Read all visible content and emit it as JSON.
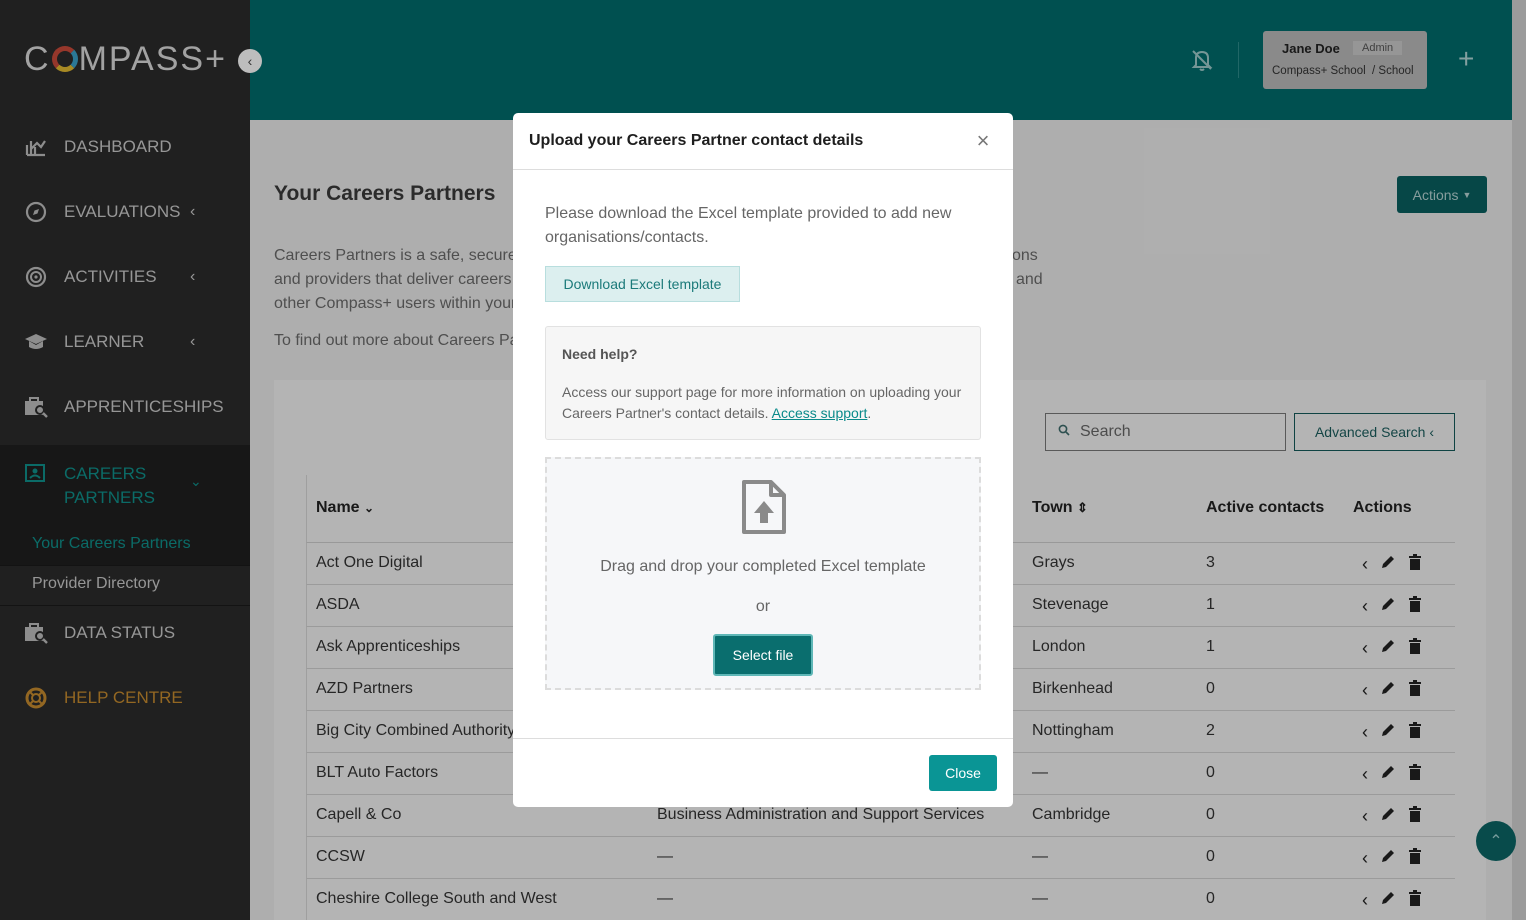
{
  "app": {
    "logo_text_left": "C",
    "logo_text_right": "MPASS+"
  },
  "sidebar": {
    "items": [
      {
        "label": "DASHBOARD",
        "icon": "chart-icon"
      },
      {
        "label": "EVALUATIONS",
        "icon": "compass-icon"
      },
      {
        "label": "ACTIVITIES",
        "icon": "target-icon"
      },
      {
        "label": "LEARNER",
        "icon": "graduation-cap-icon"
      },
      {
        "label": "APPRENTICESHIPS",
        "icon": "briefcase-search-icon"
      },
      {
        "label": "CAREERS PARTNERS",
        "icon": "id-card-icon",
        "active": true
      },
      {
        "label": "DATA STATUS",
        "icon": "briefcase-search-icon"
      },
      {
        "label": "HELP CENTRE",
        "icon": "lifebuoy-icon"
      }
    ],
    "subitems": [
      {
        "label": "Your Careers Partners",
        "active": true
      },
      {
        "label": "Provider Directory"
      }
    ]
  },
  "header": {
    "user_name": "Jane Doe",
    "user_role": "Admin",
    "user_org": "Compass+ School",
    "user_org_suffix": "/ School"
  },
  "page": {
    "title": "Your Careers Partners",
    "actions_label": "Actions",
    "intro_line1": "Careers Partners is a safe, secure",
    "intro_line1_end": "ons",
    "intro_line2": "and providers that deliver careers",
    "intro_line2_end": "and",
    "intro_line3": "other Compass+ users within your",
    "intro2": "To find out more about Careers Pa",
    "search_placeholder": "Search",
    "advanced_search_label": "Advanced Search"
  },
  "table": {
    "headers": {
      "name": "Name",
      "town": "Town",
      "active_contacts": "Active contacts",
      "actions": "Actions"
    },
    "rows": [
      {
        "name": "Act One Digital",
        "sector": "",
        "town": "Grays",
        "contacts": "3"
      },
      {
        "name": "ASDA",
        "sector": "",
        "town": "Stevenage",
        "contacts": "1"
      },
      {
        "name": "Ask Apprenticeships",
        "sector": "",
        "town": "London",
        "contacts": "1"
      },
      {
        "name": "AZD Partners",
        "sector": "",
        "town": "Birkenhead",
        "contacts": "0"
      },
      {
        "name": "Big City Combined Authority",
        "sector": "",
        "town": "Nottingham",
        "contacts": "2"
      },
      {
        "name": "BLT Auto Factors",
        "sector": "",
        "town": "—",
        "contacts": "0"
      },
      {
        "name": "Capell & Co",
        "sector": "Business Administration and Support Services",
        "town": "Cambridge",
        "contacts": "0"
      },
      {
        "name": "CCSW",
        "sector": "—",
        "town": "—",
        "contacts": "0"
      },
      {
        "name": "Cheshire College South and West",
        "sector": "—",
        "town": "—",
        "contacts": "0"
      }
    ]
  },
  "modal": {
    "title": "Upload your Careers Partner contact details",
    "description": "Please download the Excel template provided to add new organisations/contacts.",
    "download_label": "Download Excel template",
    "help_title": "Need help?",
    "help_text": "Access our support page for more information on uploading your Careers Partner's contact details. ",
    "help_link": "Access support",
    "help_text_end": ".",
    "drop_text": "Drag and drop your completed Excel template",
    "or_text": "or",
    "select_label": "Select file",
    "close_label": "Close",
    "close_icon": "×"
  },
  "colors": {
    "header": "#006b6b",
    "sidebar": "#2b2b2b",
    "accent": "#0a9595",
    "help_centre": "#c58a2e"
  }
}
